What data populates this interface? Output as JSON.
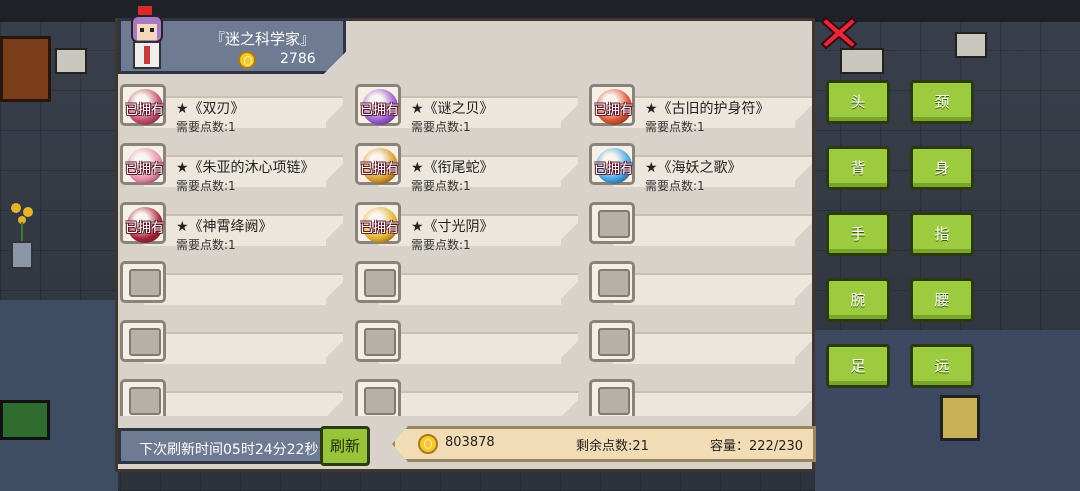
{
  "header": {
    "title": "『迷之科学家』",
    "gold": "2786"
  },
  "owned_label": "已拥有",
  "items": [
    {
      "name": "★《双刃》",
      "cost": "需要点数:1",
      "owned": true,
      "color": "#c04d6a"
    },
    {
      "name": "★《谜之贝》",
      "cost": "需要点数:1",
      "owned": true,
      "color": "#9b59d6"
    },
    {
      "name": "★《古旧的护身符》",
      "cost": "需要点数:1",
      "owned": true,
      "color": "#d9542f"
    },
    {
      "name": "★《朱亚的沐心项链》",
      "cost": "需要点数:1",
      "owned": true,
      "color": "#e48aa7"
    },
    {
      "name": "★《衔尾蛇》",
      "cost": "需要点数:1",
      "owned": true,
      "color": "#d99a28"
    },
    {
      "name": "★《海妖之歌》",
      "cost": "需要点数:1",
      "owned": true,
      "color": "#3fa3e0"
    },
    {
      "name": "★《神霄绛阙》",
      "cost": "需要点数:1",
      "owned": true,
      "color": "#a8223a"
    },
    {
      "name": "★《寸光阴》",
      "cost": "需要点数:1",
      "owned": true,
      "color": "#e0b02a"
    }
  ],
  "footer": {
    "refresh_time": "下次刷新时间05时24分22秒",
    "refresh_button": "刷新",
    "coins": "803878",
    "remaining_points": "剩余点数:21",
    "capacity": "容量：222/230"
  },
  "equipment_buttons": [
    "头",
    "颈",
    "背",
    "身",
    "手",
    "指",
    "腕",
    "腰",
    "足",
    "远"
  ]
}
